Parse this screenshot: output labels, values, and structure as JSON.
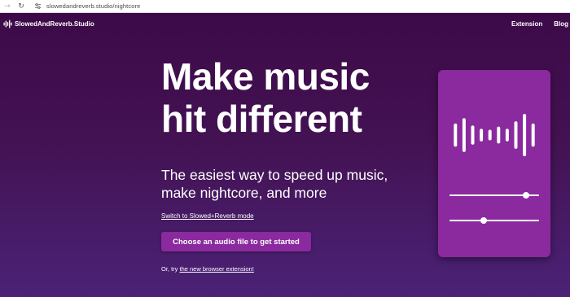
{
  "browser": {
    "url": "slowedandreverb.studio/nightcore"
  },
  "header": {
    "brand": "SlowedAndReverb.Studio",
    "nav": [
      {
        "label": "Extension"
      },
      {
        "label": "Blog"
      }
    ]
  },
  "hero": {
    "headline": [
      "Make music",
      "hit different"
    ],
    "subheadline": [
      "The easiest way to speed up music,",
      "make nightcore, and more"
    ],
    "mode_link": "Switch to Slowed+Reverb mode",
    "cta_label": "Choose an audio file to get started",
    "alt_prefix": "Or, try ",
    "alt_link": "the new browser extension!"
  },
  "card": {
    "waveform_bars": [
      0.55,
      0.8,
      0.45,
      0.3,
      0.25,
      0.4,
      0.3,
      0.65,
      1.0,
      0.55
    ],
    "sliders": [
      {
        "value": 0.85
      },
      {
        "value": 0.38
      }
    ]
  },
  "colors": {
    "background": "#3d0a49",
    "accent": "#8a2a9e",
    "text": "#ffffff"
  }
}
